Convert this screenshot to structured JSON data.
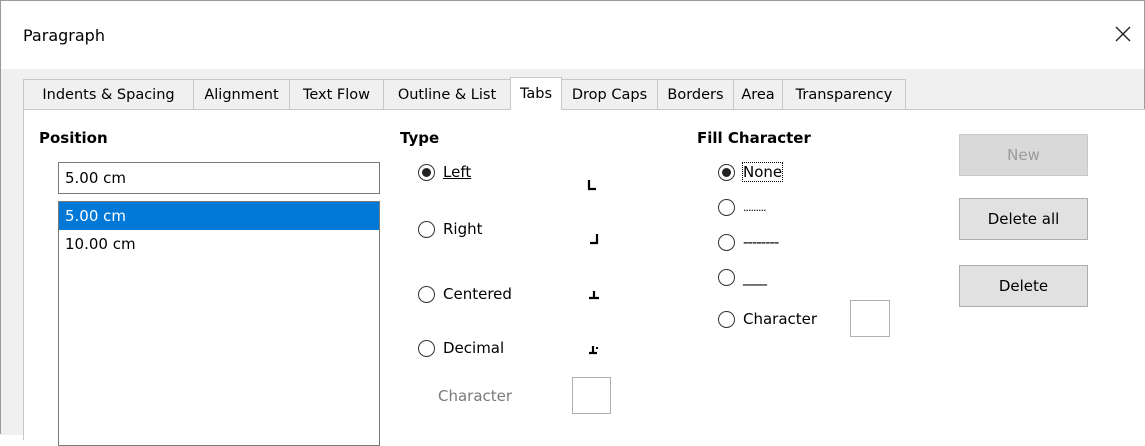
{
  "window": {
    "title": "Paragraph"
  },
  "tabs": [
    {
      "label": "Indents & Spacing",
      "active": false
    },
    {
      "label": "Alignment",
      "active": false
    },
    {
      "label": "Text Flow",
      "active": false
    },
    {
      "label": "Outline & List",
      "active": false
    },
    {
      "label": "Tabs",
      "active": true
    },
    {
      "label": "Drop Caps",
      "active": false
    },
    {
      "label": "Borders",
      "active": false
    },
    {
      "label": "Area",
      "active": false
    },
    {
      "label": "Transparency",
      "active": false
    }
  ],
  "position": {
    "header": "Position",
    "input_value": "5.00 cm",
    "list": [
      {
        "label": "5.00 cm",
        "selected": true
      },
      {
        "label": "10.00 cm",
        "selected": false
      }
    ]
  },
  "type": {
    "header": "Type",
    "options": [
      {
        "label": "Left",
        "mnemonic": "L",
        "checked": true,
        "glyph": "tab-left-icon"
      },
      {
        "label": "Right",
        "mnemonic": "h",
        "checked": false,
        "glyph": "tab-right-icon"
      },
      {
        "label": "Centered",
        "mnemonic": "e",
        "checked": false,
        "glyph": "tab-center-icon"
      },
      {
        "label": "Decimal",
        "mnemonic": "m",
        "checked": false,
        "glyph": "tab-decimal-icon"
      }
    ],
    "character_label": "Character",
    "character_value": ""
  },
  "fill": {
    "header": "Fill Character",
    "options": [
      {
        "label": "None",
        "checked": true
      },
      {
        "label": ".........",
        "checked": false
      },
      {
        "label": "--------",
        "checked": false
      },
      {
        "label": "____",
        "checked": false
      },
      {
        "label": "Character",
        "checked": false
      }
    ],
    "character_value": ""
  },
  "buttons": {
    "new": "New",
    "delete_all": "Delete all",
    "delete": "Delete"
  },
  "colors": {
    "selection": "#0078d7",
    "panel_bg": "#f0f0f0"
  }
}
